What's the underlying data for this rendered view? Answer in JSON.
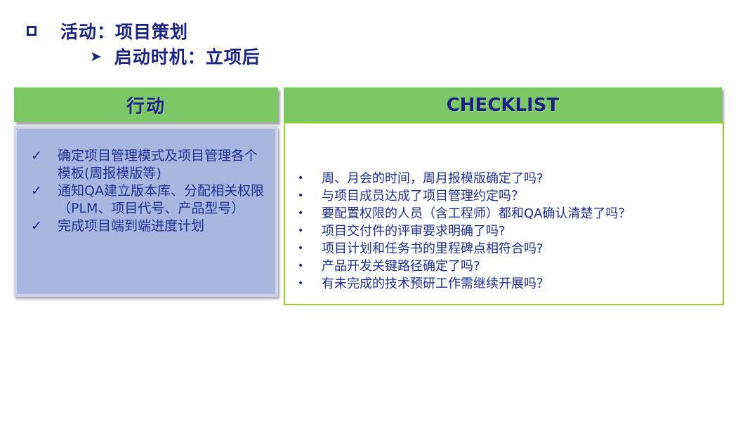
{
  "title": {
    "activity": "活动：项目策划",
    "timing": "启动时机：立项后"
  },
  "headers": {
    "action": "行动",
    "checklist": "CHECKLIST"
  },
  "actions": [
    "确定项目管理模式及项目管理各个模板(周报模版等)",
    "通知QA建立版本库、分配相关权限（PLM、项目代号、产品型号）",
    "完成项目端到端进度计划"
  ],
  "checklist": [
    "周、月会的时间，周月报模版确定了吗?",
    "与项目成员达成了项目管理约定吗？",
    "要配置权限的人员（含工程师）都和QA确认清楚了吗？",
    "项目交付件的评审要求明确了吗?",
    "项目计划和任务书的里程碑点相符合吗?",
    "产品开发关键路径确定了吗?",
    "有未完成的技术预研工作需继续开展吗？"
  ],
  "icons": {
    "square": "square-bullet-icon",
    "arrow": "arrow-bullet-icon",
    "check": "checkmark-icon",
    "dot": "dot-bullet-icon"
  },
  "colors": {
    "header_green": "#7cc765",
    "panel_blue": "#a9b7e0",
    "border_green": "#9acd32",
    "text_navy": "#1a237e"
  }
}
